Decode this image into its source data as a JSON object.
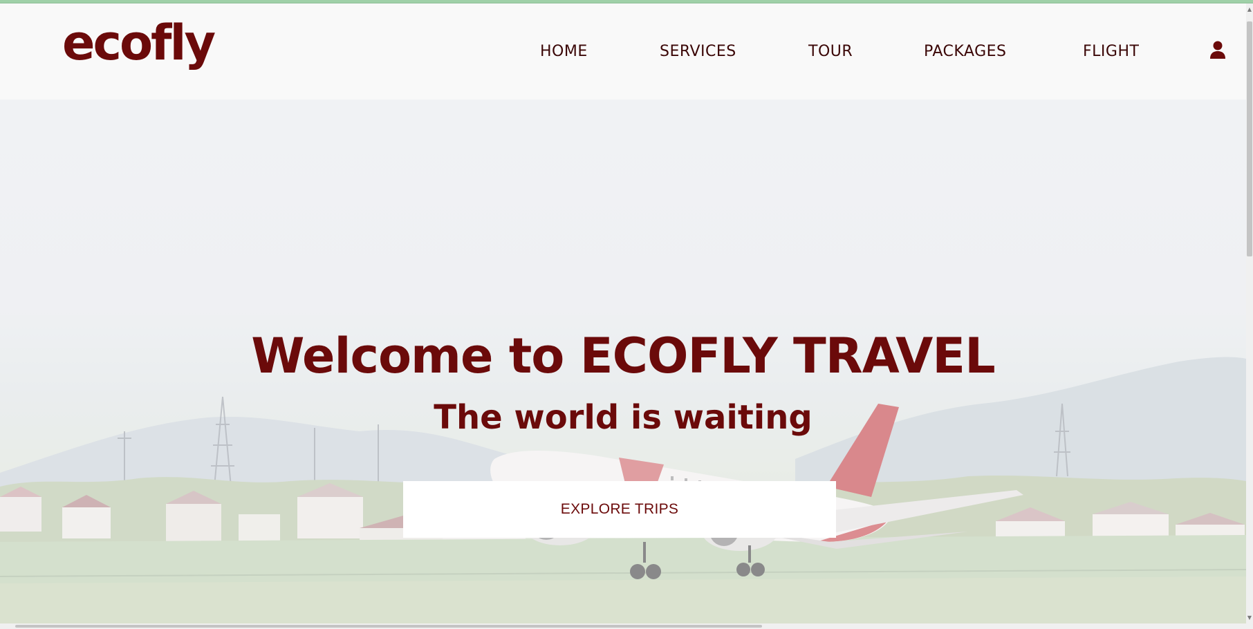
{
  "brand": {
    "logo_text": "ecofly",
    "color": "#6b0a0a"
  },
  "nav": {
    "items": [
      {
        "label": "HOME"
      },
      {
        "label": "SERVICES"
      },
      {
        "label": "TOUR"
      },
      {
        "label": "PACKAGES"
      },
      {
        "label": "FLIGHT"
      }
    ],
    "account_icon": "user-icon"
  },
  "hero": {
    "title": "Welcome to ECOFLY TRAVEL",
    "subtitle": "The world is waiting",
    "cta_label": "EXPLORE TRIPS",
    "background": "airplane-takeoff-photo"
  }
}
